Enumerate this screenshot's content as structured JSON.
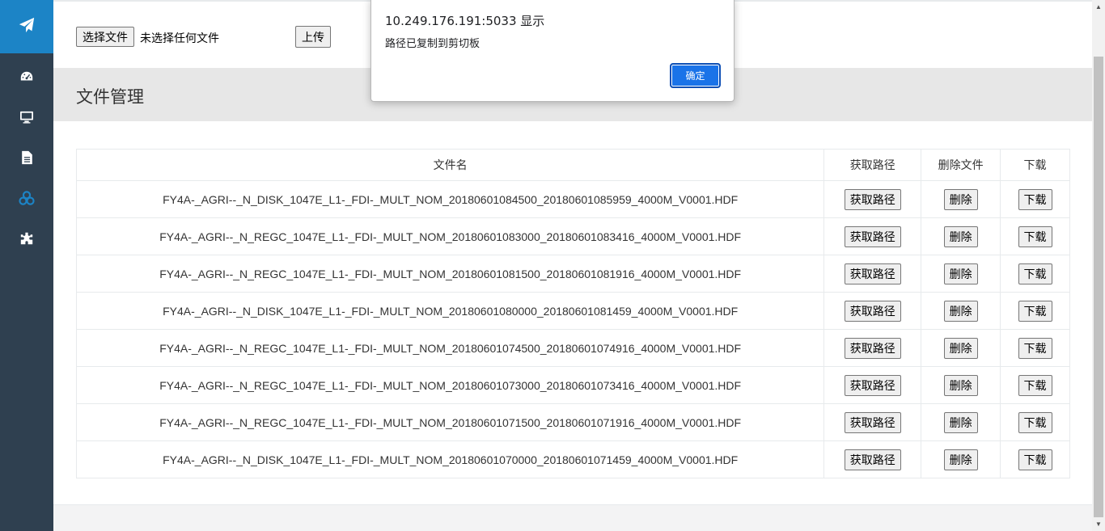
{
  "sidebar": {
    "logo_icon": "paper-plane-icon",
    "items": [
      {
        "icon": "dashboard-icon"
      },
      {
        "icon": "monitor-icon"
      },
      {
        "icon": "document-icon"
      },
      {
        "icon": "cubes-icon",
        "active": true
      },
      {
        "icon": "puzzle-icon"
      }
    ],
    "colors": {
      "background": "#2f4050",
      "logo_bg": "#1c84c6",
      "active": "#1c84c6"
    }
  },
  "upload": {
    "choose_label": "选择文件",
    "status": "未选择任何文件",
    "upload_label": "上传"
  },
  "page": {
    "title": "文件管理"
  },
  "table": {
    "headers": [
      "文件名",
      "获取路径",
      "删除文件",
      "下载"
    ],
    "path_label": "获取路径",
    "delete_label": "删除",
    "download_label": "下载",
    "rows": [
      "FY4A-_AGRI--_N_DISK_1047E_L1-_FDI-_MULT_NOM_20180601084500_20180601085959_4000M_V0001.HDF",
      "FY4A-_AGRI--_N_REGC_1047E_L1-_FDI-_MULT_NOM_20180601083000_20180601083416_4000M_V0001.HDF",
      "FY4A-_AGRI--_N_REGC_1047E_L1-_FDI-_MULT_NOM_20180601081500_20180601081916_4000M_V0001.HDF",
      "FY4A-_AGRI--_N_DISK_1047E_L1-_FDI-_MULT_NOM_20180601080000_20180601081459_4000M_V0001.HDF",
      "FY4A-_AGRI--_N_REGC_1047E_L1-_FDI-_MULT_NOM_20180601074500_20180601074916_4000M_V0001.HDF",
      "FY4A-_AGRI--_N_REGC_1047E_L1-_FDI-_MULT_NOM_20180601073000_20180601073416_4000M_V0001.HDF",
      "FY4A-_AGRI--_N_REGC_1047E_L1-_FDI-_MULT_NOM_20180601071500_20180601071916_4000M_V0001.HDF",
      "FY4A-_AGRI--_N_DISK_1047E_L1-_FDI-_MULT_NOM_20180601070000_20180601071459_4000M_V0001.HDF"
    ]
  },
  "dialog": {
    "origin": "10.249.176.191:5033 显示",
    "message": "路径已复制到剪切板",
    "ok_label": "确定",
    "accent": "#1a73e8"
  }
}
